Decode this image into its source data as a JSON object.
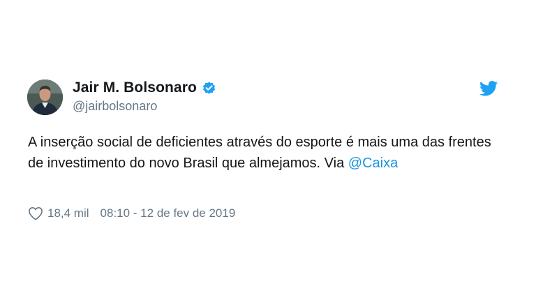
{
  "tweet": {
    "author": {
      "display_name": "Jair M. Bolsonaro",
      "handle": "@jairbolsonaro",
      "verified": true
    },
    "text_before_mention": "A inserção social de deficientes através do esporte é mais uma das frentes de investimento do novo Brasil que almejamos. Via ",
    "mention": "@Caixa",
    "likes": "18,4 mil",
    "timestamp": "08:10 - 12 de fev de 2019"
  },
  "colors": {
    "text": "#14171a",
    "secondary": "#657786",
    "link": "#1b95e0",
    "twitter_blue": "#1da1f2"
  },
  "icons": {
    "brand": "twitter-bird-icon",
    "verified": "verified-badge-icon",
    "like": "heart-icon"
  }
}
